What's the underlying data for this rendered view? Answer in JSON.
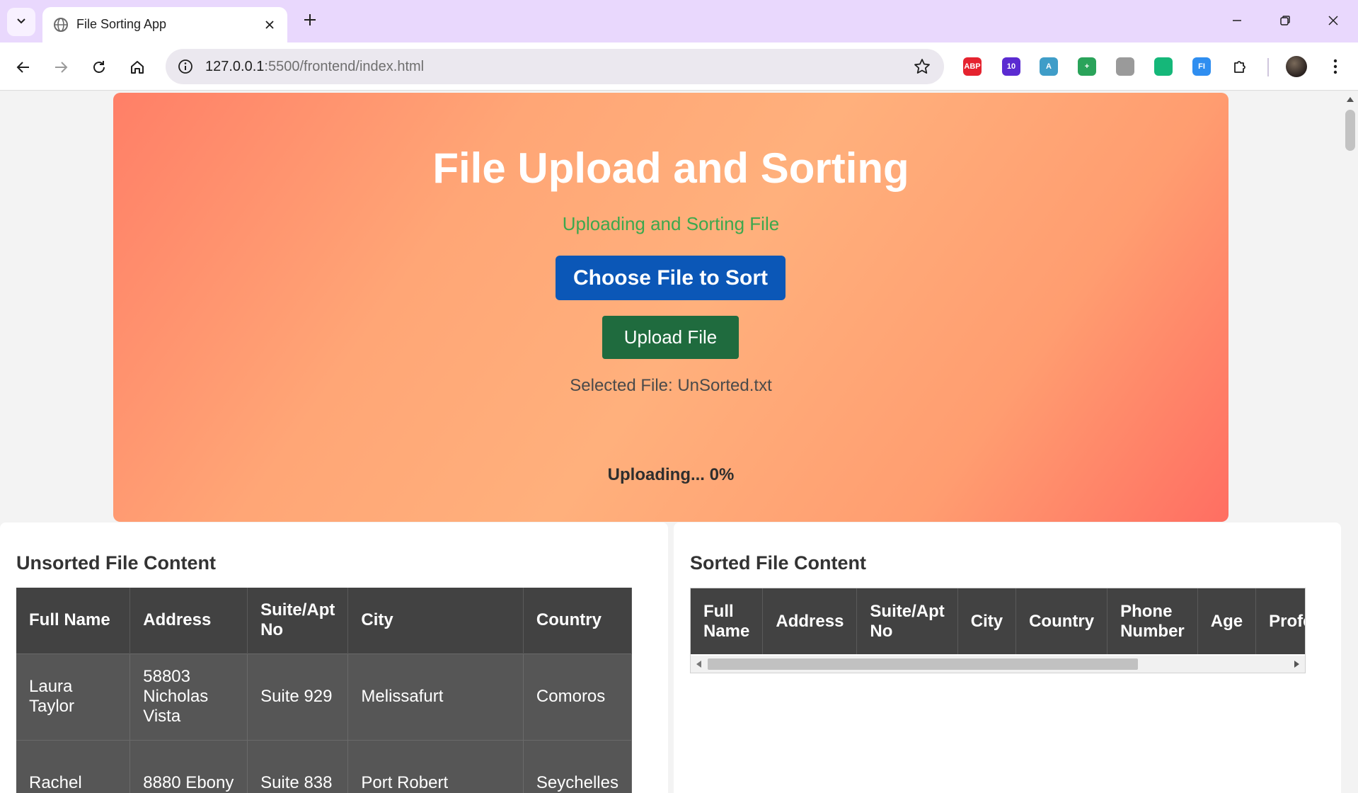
{
  "browser": {
    "tab_title": "File Sorting App",
    "url_host": "127.0.0.1",
    "url_rest": ":5500/frontend/index.html",
    "extensions": [
      {
        "name": "adblock-plus-icon",
        "label": "ABP",
        "color": "#e5232f"
      },
      {
        "name": "graduation-cap-icon",
        "label": "10",
        "color": "#5b2bd1"
      },
      {
        "name": "text-a-icon",
        "label": "A",
        "color": "#3f9dc8"
      },
      {
        "name": "add-doc-icon",
        "label": "+",
        "color": "#2aa35a"
      },
      {
        "name": "camera-icon",
        "label": "",
        "color": "#9a9a9a"
      },
      {
        "name": "sync-icon",
        "label": "",
        "color": "#15b779"
      },
      {
        "name": "fi-icon",
        "label": "FI",
        "color": "#2f8ef0"
      }
    ]
  },
  "hero": {
    "title": "File Upload and Sorting",
    "status": "Uploading and Sorting File",
    "choose_button": "Choose File to Sort",
    "upload_button": "Upload File",
    "selected_file": "Selected File: UnSorted.txt",
    "progress_text": "Uploading... 0%",
    "progress": 0
  },
  "unsorted": {
    "title": "Unsorted File Content",
    "headers": [
      "Full Name",
      "Address",
      "Suite/Apt No",
      "City",
      "Country"
    ],
    "rows": [
      [
        "Laura Taylor",
        "58803 Nicholas Vista",
        "Suite 929",
        "Melissafurt",
        "Comoros"
      ],
      [
        "Rachel",
        "8880 Ebony",
        "Suite 838",
        "Port Robert",
        "Seychelles"
      ]
    ]
  },
  "sorted": {
    "title": "Sorted File Content",
    "headers": [
      "Full Name",
      "Address",
      "Suite/Apt No",
      "City",
      "Country",
      "Phone Number",
      "Age",
      "Profe"
    ]
  },
  "colors": {
    "choose_button": "#0b57b7",
    "upload_button": "#1f6b3e",
    "status_text": "#3da84d",
    "table_header": "#424242"
  }
}
